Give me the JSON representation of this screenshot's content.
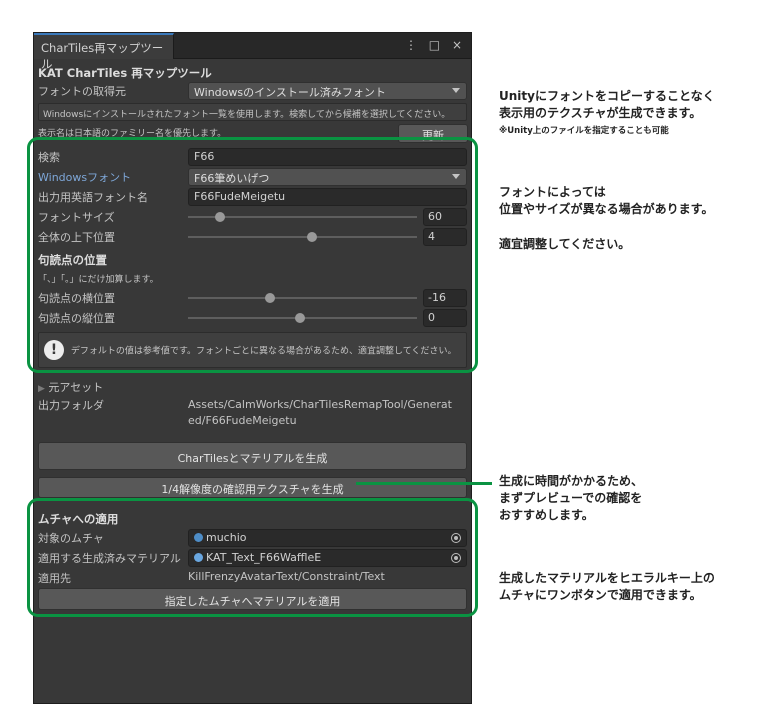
{
  "window": {
    "tab_title": "CharTiles再マップツール",
    "controls": [
      "⋮",
      "□",
      "×"
    ]
  },
  "top": {
    "heading": "KAT CharTiles 再マップツール",
    "font_source_label": "フォントの取得元",
    "font_source_value": "Windowsのインストール済みフォント",
    "info_line": "Windowsにインストールされたフォント一覧を使用します。検索してから候補を選択してください。",
    "display_name_note": "表示名は日本語のファミリー名を優先します。",
    "refresh_button": "更新"
  },
  "settings": {
    "search_label": "検索",
    "search_value": "F66",
    "windows_font_label": "Windowsフォント",
    "windows_font_value": "F66筆めいげつ",
    "english_name_label": "出力用英語フォント名",
    "english_name_value": "F66FudeMeigetu",
    "font_size_label": "フォントサイズ",
    "font_size_value": "60",
    "font_size_fill": 0.14,
    "vertical_pos_label": "全体の上下位置",
    "vertical_pos_value": "4",
    "vertical_pos_fill": 0.54,
    "punct_heading": "句読点の位置",
    "punct_note": "「、」「。」にだけ加算します。",
    "punct_h_label": "句読点の横位置",
    "punct_h_value": "-16",
    "punct_h_fill": 0.36,
    "punct_v_label": "句読点の縦位置",
    "punct_v_value": "0",
    "punct_v_fill": 0.49,
    "warning_text": "デフォルトの値は参考値です。フォントごとに異なる場合があるため、適宜調整してください。"
  },
  "preset": {
    "label": "元アセット",
    "output_folder_label": "出力フォルダ",
    "output_folder_line1": "Assets/CalmWorks/CharTilesRemapTool/Generat",
    "output_folder_line2": "ed/F66FudeMeigetu",
    "generate_button": "CharTilesとマテリアルを生成",
    "preview_button": "1/4解像度の確認用テクスチャを生成"
  },
  "apply": {
    "heading": "ムチャへの適用",
    "target_label": "対象のムチャ",
    "target_value": "muchio",
    "material_label": "適用する生成済みマテリアル",
    "material_value": "KAT_Text_F66WaffleE",
    "dest_label": "適用先",
    "dest_value": "KillFrenzyAvatarText/Constraint/Text",
    "apply_button": "指定したムチャへマテリアルを適用"
  },
  "notes": {
    "n1_line1": "Unityにフォントをコピーすることなく",
    "n1_line2": "表示用のテクスチャが生成できます。",
    "n1_small": "※Unity上のファイルを指定することも可能",
    "n2_line1": "フォントによっては",
    "n2_line2": "位置やサイズが異なる場合があります。",
    "n3": "適宜調整してください。",
    "n4_line1": "生成に時間がかかるため、",
    "n4_line2": "まずプレビューでの確認を",
    "n4_line3": "おすすめします。",
    "n5_line1": "生成したマテリアルをヒエラルキー上の",
    "n5_line2": "ムチャにワンボタンで適用できます。"
  },
  "colors": {
    "highlight_green": "#0a9342",
    "panel_bg": "#383838",
    "label_blue": "#7ea7d8"
  }
}
